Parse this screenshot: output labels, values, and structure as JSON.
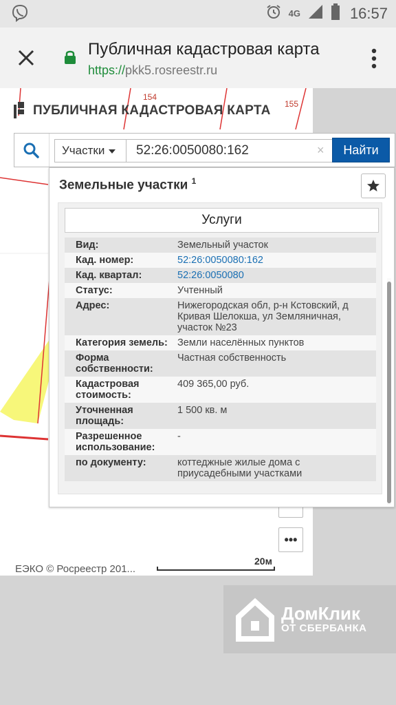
{
  "status_bar": {
    "network": "4G",
    "time": "16:57"
  },
  "browser": {
    "page_title": "Публичная кадастровая карта",
    "url_scheme": "https://",
    "url_host": "pkk5.rosreestr.ru"
  },
  "map": {
    "logo_title": "ПУБЛИЧНАЯ КАДАСТРОВАЯ КАРТА",
    "plot_labels": [
      "154",
      "155"
    ],
    "copyright": "ЕЭКО © Росреестр 201...",
    "scale_label": "20м",
    "more_label": "•••"
  },
  "search": {
    "category": "Участки",
    "query": "52:26:0050080:162",
    "clear": "×",
    "submit_label": "Найти"
  },
  "panel": {
    "title": "Земельные участки",
    "title_sup": "1",
    "services_label": "Услуги",
    "rows": [
      {
        "key": "Вид:",
        "value": "Земельный участок"
      },
      {
        "key": "Кад. номер:",
        "value": "52:26:0050080:162"
      },
      {
        "key": "Кад. квартал:",
        "value": "52:26:0050080"
      },
      {
        "key": "Статус:",
        "value": "Учтенный"
      },
      {
        "key": "Адрес:",
        "value": "Нижегородская обл, р-н Кстовский, д Кривая Шелокша, ул Земляничная, участок №23"
      },
      {
        "key": "Категория земель:",
        "value": "Земли населённых пунктов"
      },
      {
        "key": "Форма собственности:",
        "value": "Частная собственность"
      },
      {
        "key": "Кадастровая стоимость:",
        "value": "409 365,00 руб."
      },
      {
        "key": "Уточненная площадь:",
        "value": "1 500 кв. м"
      },
      {
        "key": "Разрешенное использование:",
        "value": "-"
      },
      {
        "key": "по документу:",
        "value": "коттеджные жилые дома с приусадебными участками"
      }
    ]
  },
  "watermark": {
    "title": "ДомКлик",
    "subtitle": "ОТ СБЕРБАНКА"
  }
}
